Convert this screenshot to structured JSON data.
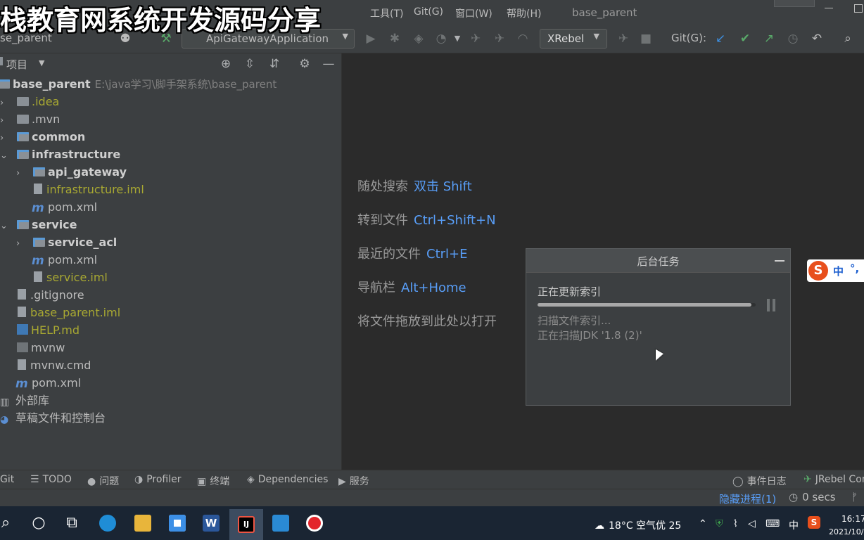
{
  "overlay": {
    "title": "栈教育网系统开发源码分享"
  },
  "menubar": {
    "items": [
      "工具(T)",
      "Git(G)",
      "窗口(W)",
      "帮助(H)"
    ],
    "project_title": "base_parent"
  },
  "toolbar": {
    "breadcrumb": "se_parent",
    "run_config": "ApiGatewayApplication",
    "xrebel": "XRebel",
    "git_label": "Git(G):"
  },
  "project_panel": {
    "title": "项目",
    "root": {
      "name": "base_parent",
      "path": "E:\\java学习\\脚手架系统\\base_parent"
    },
    "tree": [
      {
        "name": ".idea"
      },
      {
        "name": ".mvn"
      },
      {
        "name": "common"
      },
      {
        "name": "infrastructure"
      },
      {
        "name": "api_gateway"
      },
      {
        "name": "infrastructure.iml"
      },
      {
        "name": "pom.xml"
      },
      {
        "name": "service"
      },
      {
        "name": "service_acl"
      },
      {
        "name": "pom.xml"
      },
      {
        "name": "service.iml"
      },
      {
        "name": ".gitignore"
      },
      {
        "name": "base_parent.iml"
      },
      {
        "name": "HELP.md"
      },
      {
        "name": "mvnw"
      },
      {
        "name": "mvnw.cmd"
      },
      {
        "name": "pom.xml"
      },
      {
        "name": "外部库"
      },
      {
        "name": "草稿文件和控制台"
      }
    ]
  },
  "editor": {
    "hints": [
      {
        "label": "随处搜索",
        "key": "双击 Shift"
      },
      {
        "label": "转到文件",
        "key": "Ctrl+Shift+N"
      },
      {
        "label": "最近的文件",
        "key": "Ctrl+E"
      },
      {
        "label": "导航栏",
        "key": "Alt+Home"
      },
      {
        "label": "将文件拖放到此处以打开",
        "key": ""
      }
    ]
  },
  "background_tasks": {
    "title": "后台任务",
    "task_title": "正在更新索引",
    "progress": 0.98,
    "subtitle1": "扫描文件索引...",
    "subtitle2": "正在扫描JDK '1.8 (2)'"
  },
  "ime": {
    "lang": "中",
    "punct": "°,"
  },
  "toolwindows": {
    "git": "Git",
    "todo": "TODO",
    "problems": "问题",
    "profiler": "Profiler",
    "terminal": "终端",
    "dependencies": "Dependencies",
    "services": "服务",
    "event_log": "事件日志",
    "jrebel": "JRebel Con"
  },
  "statusbar": {
    "hidden_processes": "隐藏进程(1)",
    "secs": "0 secs"
  },
  "taskbar": {
    "weather": "18°C  空气优 25",
    "ime_lang": "中",
    "time": "16:17",
    "date": "2021/10/"
  },
  "colors": {
    "accent_blue": "#589df6",
    "iml_yellow": "#a8a832",
    "panel_bg": "#3c3f41",
    "editor_bg": "#2b2b2b"
  }
}
